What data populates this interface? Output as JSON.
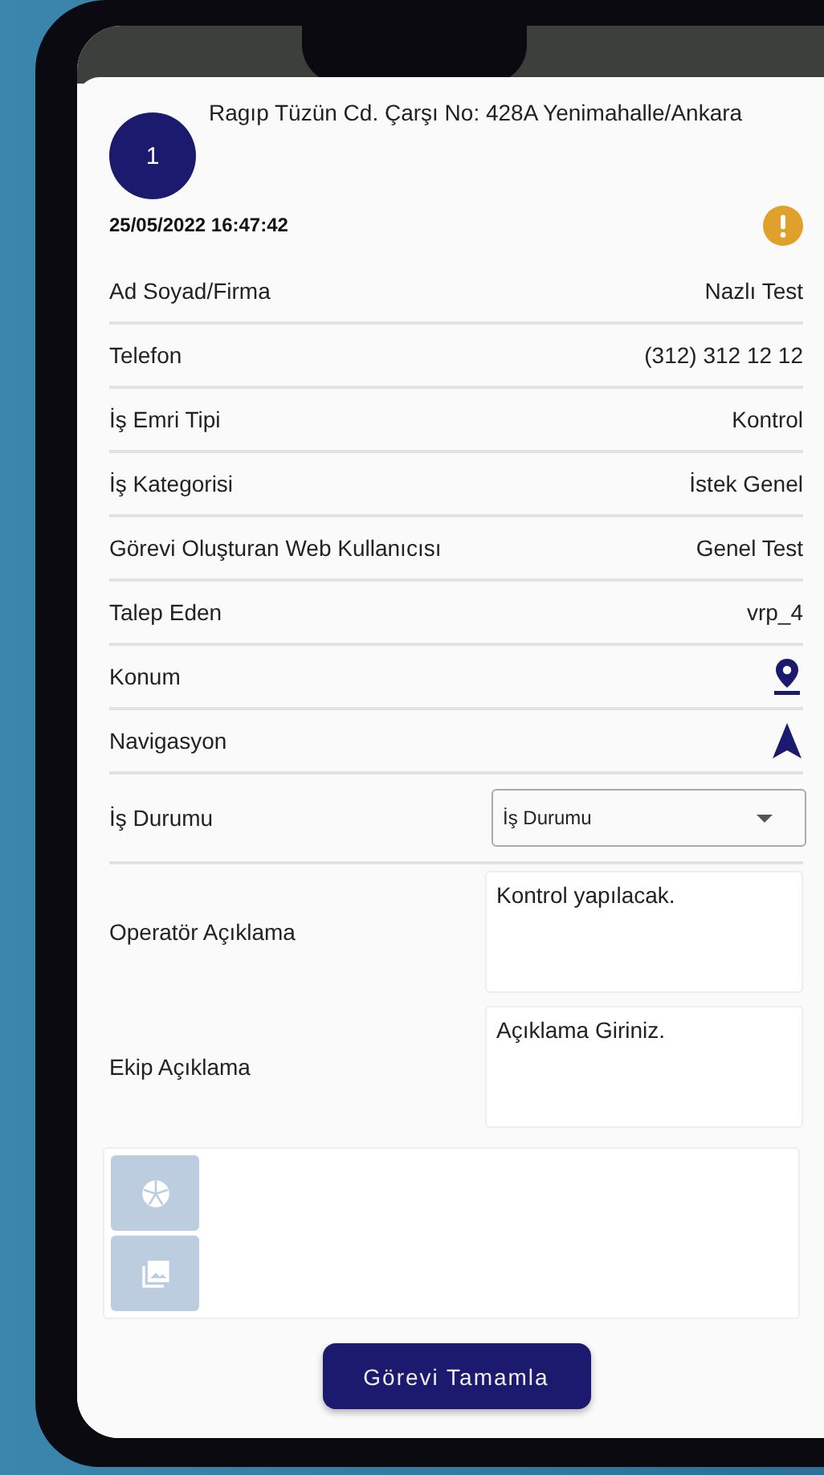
{
  "order_badge": "1",
  "address": "Ragıp Tüzün Cd. Çarşı No: 428A Yenimahalle/Ankara",
  "datetime": "25/05/2022 16:47:42",
  "alert": true,
  "rows": [
    {
      "kind": "text",
      "label": "Ad Soyad/Firma",
      "value": "Nazlı Test"
    },
    {
      "kind": "text",
      "label": "Telefon",
      "value": "(312) 312 12 12"
    },
    {
      "kind": "text",
      "label": "İş Emri Tipi",
      "value": "Kontrol"
    },
    {
      "kind": "text",
      "label": "İş Kategorisi",
      "value": "İstek Genel"
    },
    {
      "kind": "text",
      "label": "Görevi Oluşturan Web Kullanıcısı",
      "value": "Genel Test"
    },
    {
      "kind": "text",
      "label": "Talep Eden",
      "value": "vrp_4"
    },
    {
      "kind": "location",
      "label": "Konum"
    },
    {
      "kind": "navigation",
      "label": "Navigasyon"
    },
    {
      "kind": "select",
      "label": "İş Durumu",
      "placeholder": "İş Durumu"
    },
    {
      "kind": "textarea",
      "label": "Operatör Açıklama",
      "value": "Kontrol yapılacak."
    },
    {
      "kind": "textarea",
      "label": "Ekip Açıklama",
      "placeholder": "Açıklama Giriniz."
    }
  ],
  "attachments": {
    "camera_disabled": true,
    "gallery_disabled": true
  },
  "complete_button": "Görevi Tamamla"
}
